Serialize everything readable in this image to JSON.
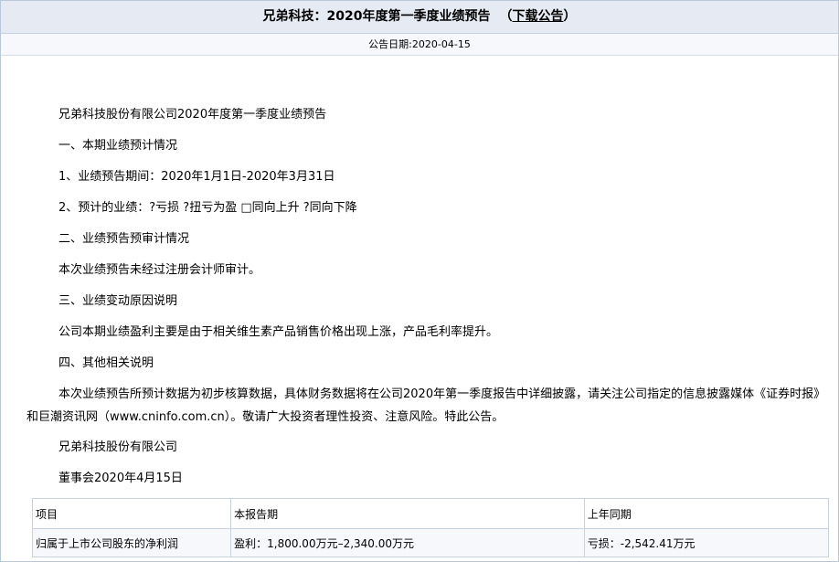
{
  "header": {
    "title": "兄弟科技：2020年度第一季度业绩预告",
    "download_open": "（",
    "download_label": "下载公告",
    "download_close": "）",
    "date_label": "公告日期:",
    "date_value": "2020-04-15"
  },
  "body": {
    "p1": "兄弟科技股份有限公司2020年度第一季度业绩预告",
    "p2": "一、本期业绩预计情况",
    "p3": "1、业绩预告期间：2020年1月1日-2020年3月31日",
    "p4": "2、预计的业绩：?亏损 ?扭亏为盈 □同向上升 ?同向下降",
    "p5": "二、业绩预告预审计情况",
    "p6": "本次业绩预告未经过注册会计师审计。",
    "p7": "三、业绩变动原因说明",
    "p8": "公司本期业绩盈利主要是由于相关维生素产品销售价格出现上涨，产品毛利率提升。",
    "p9": "四、其他相关说明",
    "p10": "本次业绩预告所预计数据为初步核算数据，具体财务数据将在公司2020年第一季度报告中详细披露，请关注公司指定的信息披露媒体《证券时报》和巨潮资讯网（www.cninfo.com.cn）。敬请广大投资者理性投资、注意风险。特此公告。",
    "p11": "兄弟科技股份有限公司",
    "p12": "董事会2020年4月15日"
  },
  "table": {
    "headers": [
      "项目",
      "本报告期",
      "上年同期"
    ],
    "rows": [
      [
        "归属于上市公司股东的净利润",
        "盈利：1,800.00万元–2,340.00万元",
        "亏损：-2,542.41万元"
      ]
    ]
  }
}
